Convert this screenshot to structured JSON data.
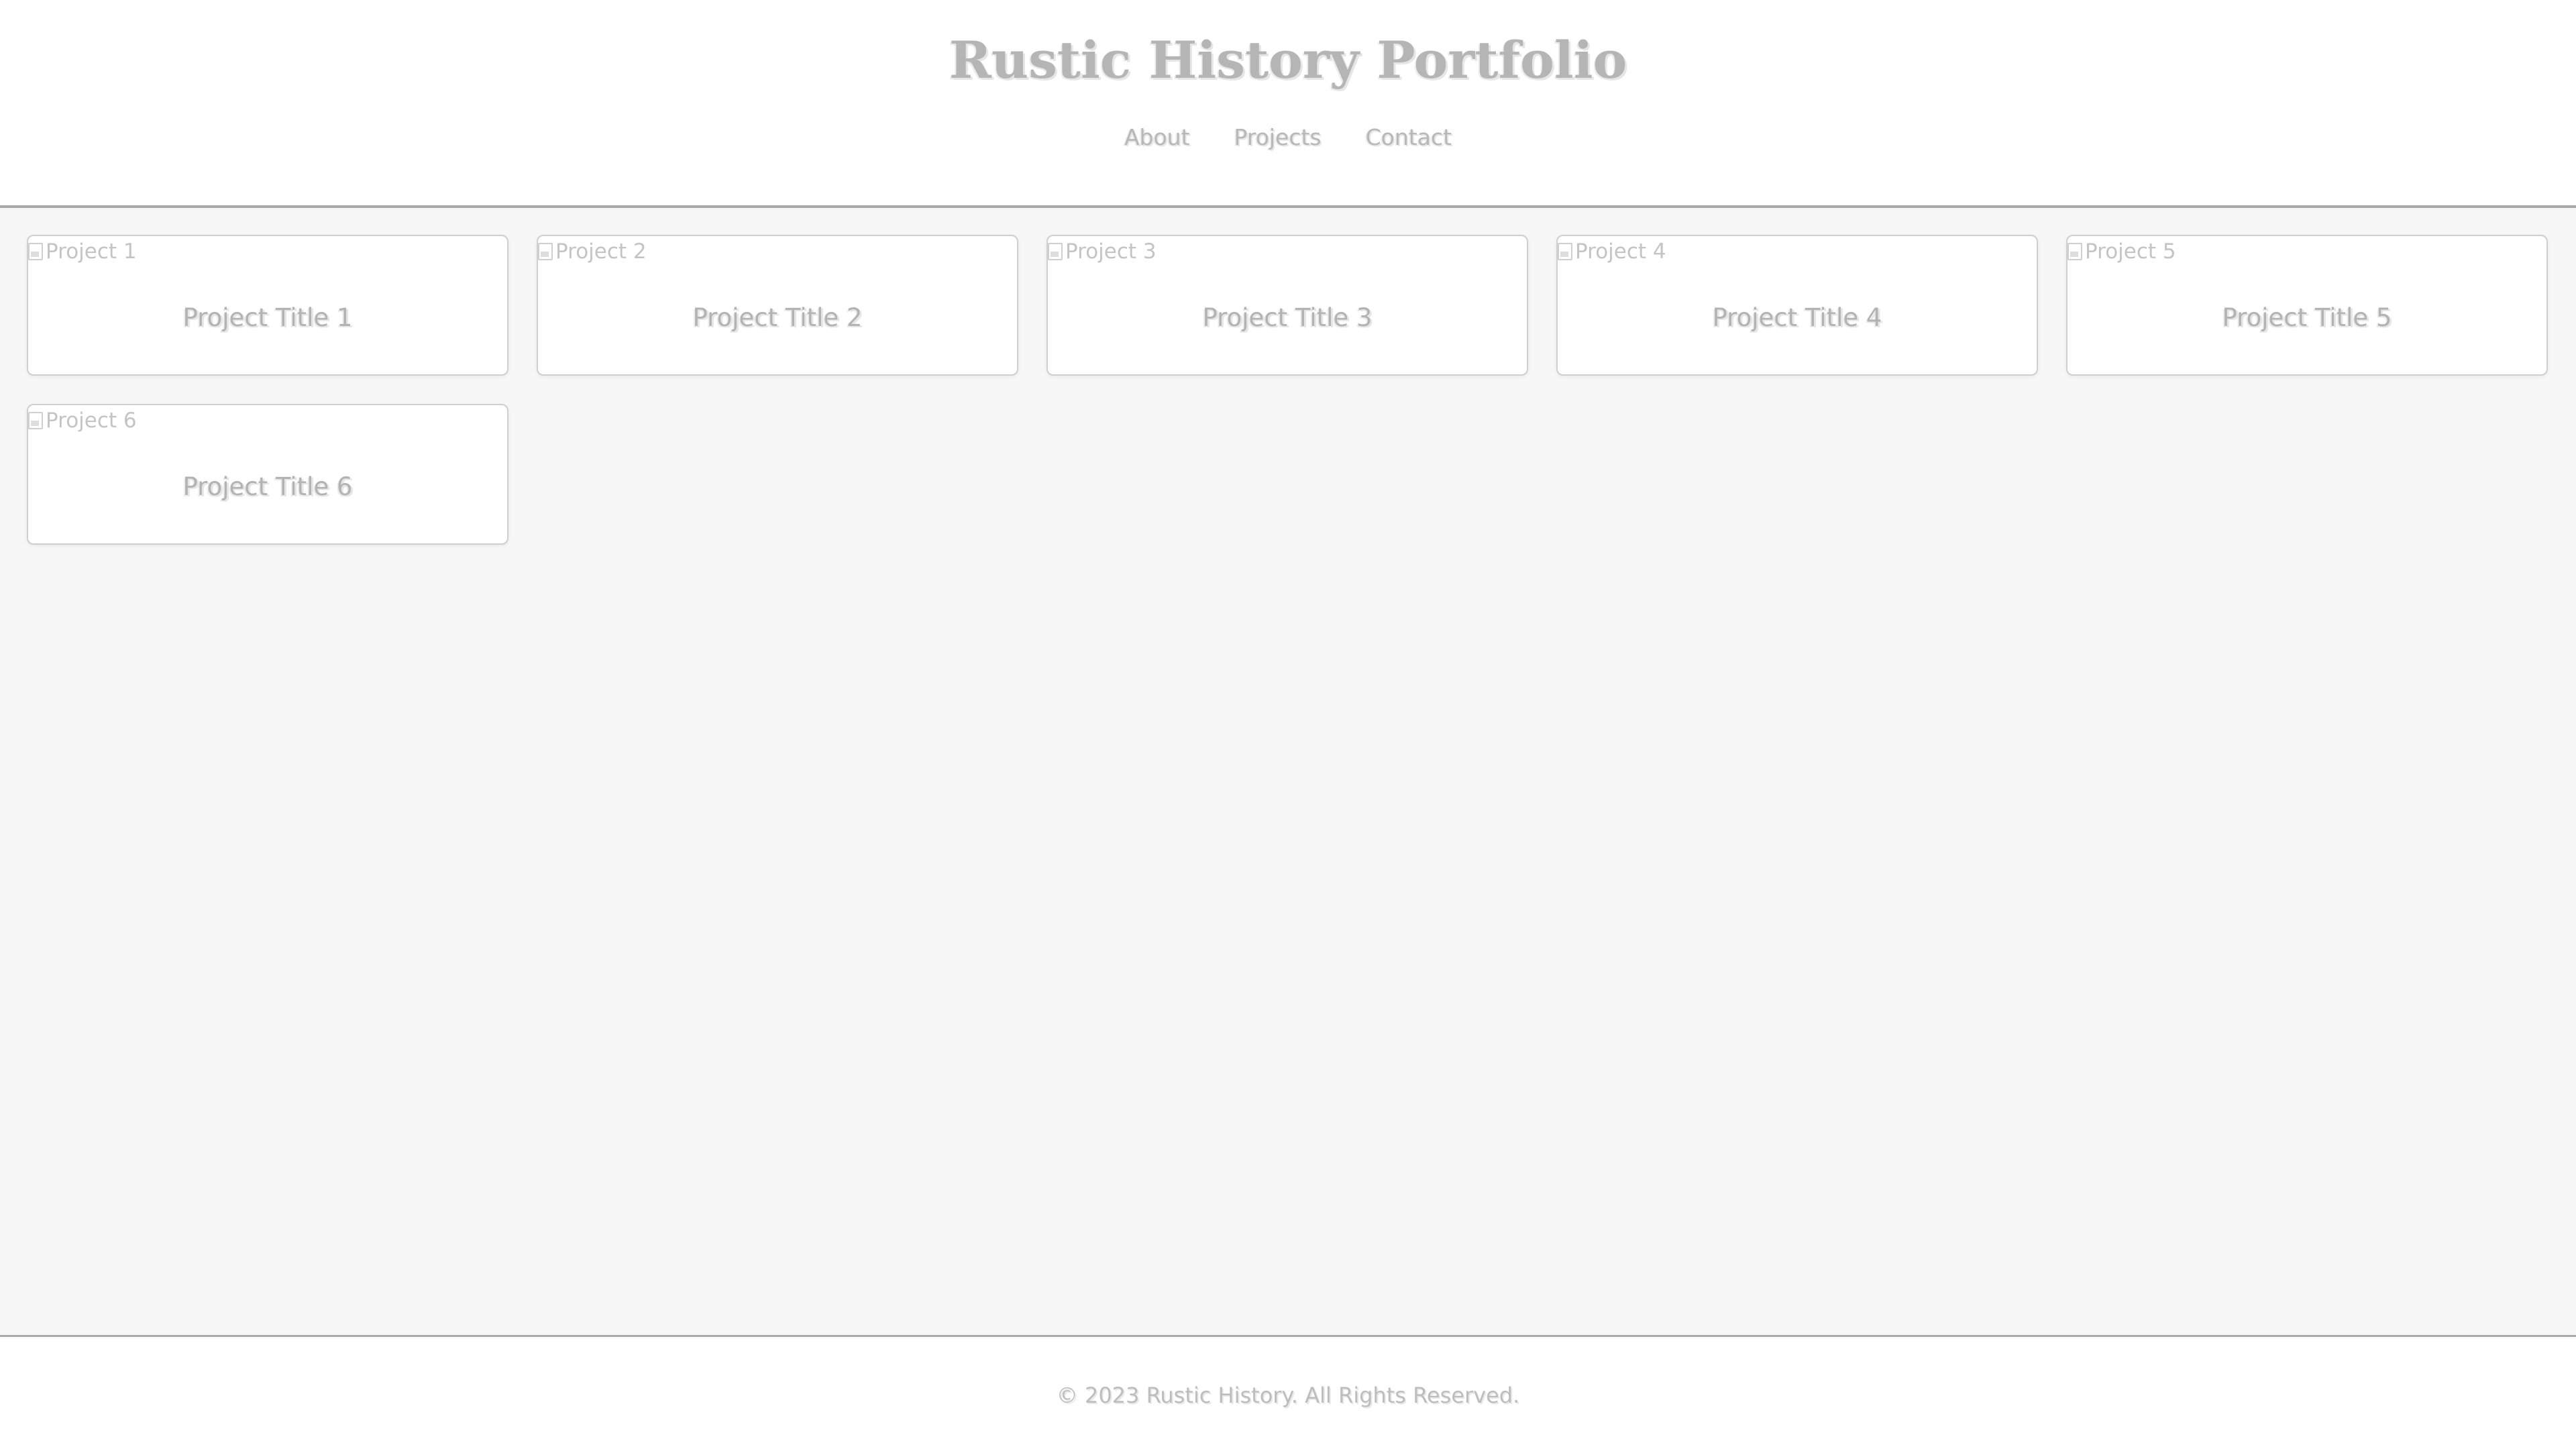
{
  "site": {
    "title": "Rustic History Portfolio"
  },
  "nav": {
    "items": [
      {
        "label": "About"
      },
      {
        "label": "Projects"
      },
      {
        "label": "Contact"
      }
    ]
  },
  "projects": [
    {
      "image_alt": "Project 1",
      "title": "Project Title 1"
    },
    {
      "image_alt": "Project 2",
      "title": "Project Title 2"
    },
    {
      "image_alt": "Project 3",
      "title": "Project Title 3"
    },
    {
      "image_alt": "Project 4",
      "title": "Project Title 4"
    },
    {
      "image_alt": "Project 5",
      "title": "Project Title 5"
    },
    {
      "image_alt": "Project 6",
      "title": "Project Title 6"
    }
  ],
  "footer": {
    "copyright": "© 2023 Rustic History. All Rights Reserved."
  },
  "colors": {
    "background": "#f7f7f7",
    "surface": "#ffffff",
    "text": "#b3b3b3",
    "border": "#cfcfcf",
    "divider": "#a9a9a9"
  }
}
